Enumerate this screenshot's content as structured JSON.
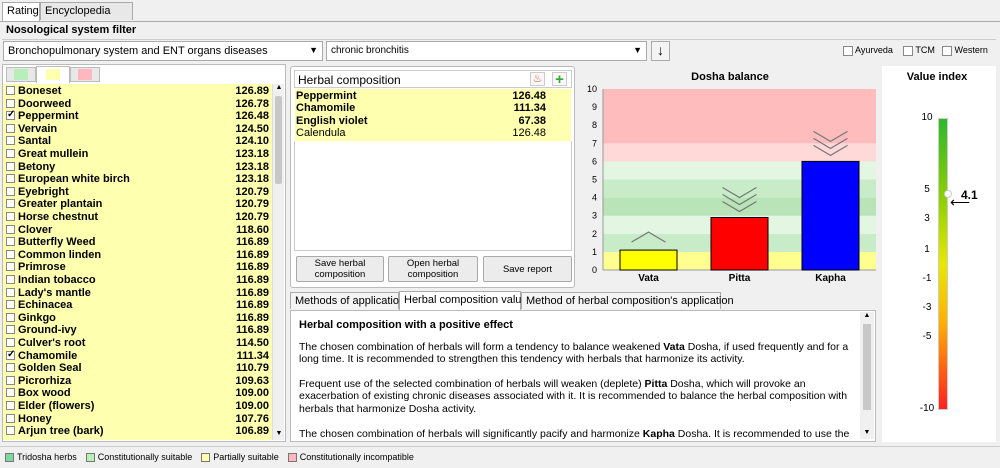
{
  "tabs": {
    "rating": "Rating",
    "encyclopedia": "Encyclopedia"
  },
  "filter": {
    "title": "Nosological system filter",
    "system": "Bronchopulmonary system and ENT organs diseases",
    "disease": "chronic bronchitis",
    "options": [
      "Ayurveda",
      "TCM",
      "Western"
    ]
  },
  "herbs": [
    {
      "name": "Boneset",
      "value": "126.89",
      "checked": false
    },
    {
      "name": "Doorweed",
      "value": "126.78",
      "checked": false
    },
    {
      "name": "Peppermint",
      "value": "126.48",
      "checked": true
    },
    {
      "name": "Vervain",
      "value": "124.50",
      "checked": false
    },
    {
      "name": "Santal",
      "value": "124.10",
      "checked": false
    },
    {
      "name": "Great mullein",
      "value": "123.18",
      "checked": false
    },
    {
      "name": "Betony",
      "value": "123.18",
      "checked": false
    },
    {
      "name": "European white birch",
      "value": "123.18",
      "checked": false
    },
    {
      "name": "Eyebright",
      "value": "120.79",
      "checked": false
    },
    {
      "name": "Greater plantain",
      "value": "120.79",
      "checked": false
    },
    {
      "name": "Horse chestnut",
      "value": "120.79",
      "checked": false
    },
    {
      "name": "Clover",
      "value": "118.60",
      "checked": false
    },
    {
      "name": "Butterfly Weed",
      "value": "116.89",
      "checked": false
    },
    {
      "name": "Common linden",
      "value": "116.89",
      "checked": false
    },
    {
      "name": "Primrose",
      "value": "116.89",
      "checked": false
    },
    {
      "name": "Indian tobacco",
      "value": "116.89",
      "checked": false
    },
    {
      "name": "Lady's mantle",
      "value": "116.89",
      "checked": false
    },
    {
      "name": "Echinacea",
      "value": "116.89",
      "checked": false
    },
    {
      "name": "Ginkgo",
      "value": "116.89",
      "checked": false
    },
    {
      "name": "Ground-ivy",
      "value": "116.89",
      "checked": false
    },
    {
      "name": "Culver's root",
      "value": "114.50",
      "checked": false
    },
    {
      "name": "Chamomile",
      "value": "111.34",
      "checked": true
    },
    {
      "name": "Golden Seal",
      "value": "110.79",
      "checked": false
    },
    {
      "name": "Picrorhiza",
      "value": "109.63",
      "checked": false
    },
    {
      "name": "Box wood",
      "value": "109.00",
      "checked": false
    },
    {
      "name": "Elder (flowers)",
      "value": "109.00",
      "checked": false
    },
    {
      "name": "Honey",
      "value": "107.76",
      "checked": false
    },
    {
      "name": "Arjun tree (bark)",
      "value": "106.89",
      "checked": false
    }
  ],
  "composition": {
    "title": "Herbal composition",
    "items": [
      {
        "name": "Peppermint",
        "value": "126.48",
        "bold": true
      },
      {
        "name": "Chamomile",
        "value": "111.34",
        "bold": true
      },
      {
        "name": "English violet",
        "value": "67.38",
        "bold": true
      },
      {
        "name": "Calendula",
        "value": "126.48",
        "bold": false
      }
    ],
    "buttons": {
      "save": "Save herbal composition",
      "open": "Open herbal composition",
      "report": "Save report"
    }
  },
  "chart_data": {
    "type": "bar",
    "title": "Dosha balance",
    "categories": [
      "Vata",
      "Pitta",
      "Kapha"
    ],
    "values": [
      1.1,
      2.9,
      6.0
    ],
    "colors": [
      "#ffff00",
      "#ff0000",
      "#0000ff"
    ],
    "arrows": [
      "up",
      "down",
      "down"
    ],
    "ylim": [
      0,
      10
    ],
    "yticks": [
      "0",
      "1",
      "2",
      "3",
      "4",
      "5",
      "6",
      "7",
      "8",
      "9",
      "10"
    ]
  },
  "value_index": {
    "title": "Value index",
    "current": "4.1",
    "ticks": [
      "10",
      "5",
      "3",
      "1",
      "-1",
      "-3",
      "-5",
      "-10"
    ]
  },
  "bottom_tabs": {
    "methods": "Methods of application",
    "value": "Herbal composition value",
    "method_comp": "Method of herbal composition's application"
  },
  "description": {
    "heading": "Herbal composition with a positive effect",
    "p1_a": "The chosen combination of herbals will form a tendency to balance weakened ",
    "p1_b": "Vata",
    "p1_c": " Dosha, if used frequently and for a long time. It is recommended to strengthen this tendency with herbals that harmonize its activity.",
    "p2_a": "Frequent use of the selected combination of herbals will weaken (deplete) ",
    "p2_b": "Pitta",
    "p2_c": " Dosha, which will provoke an exacerbation of existing chronic diseases associated with it. It is recommended to balance the herbal composition with herbals that harmonize Dosha activity.",
    "p3_a": "The chosen combination of herbals will significantly pacify and harmonize ",
    "p3_b": "Kapha",
    "p3_c": " Dosha. It is recommended to use the"
  },
  "legend": [
    {
      "label": "Tridosha herbs",
      "color": "#7fd7a0"
    },
    {
      "label": "Constitutionally suitable",
      "color": "#b8eeb8"
    },
    {
      "label": "Partially suitable",
      "color": "#ffffb0"
    },
    {
      "label": "Constitutionally incompatible",
      "color": "#ffb8c0"
    }
  ]
}
